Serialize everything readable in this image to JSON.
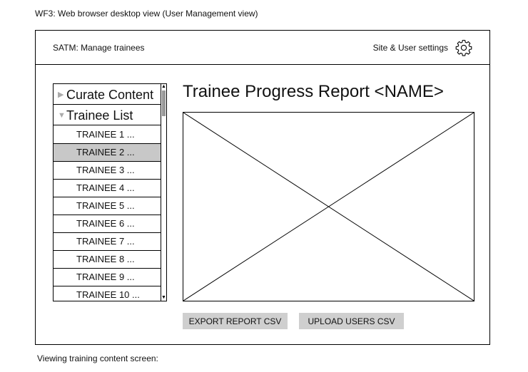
{
  "captions": {
    "top": "WF3: Web browser desktop view (User Management view)",
    "bottom": "Viewing training content screen:"
  },
  "header": {
    "app_title": "SATM: Manage trainees",
    "settings_label": "Site & User settings",
    "settings_icon": "gear-icon"
  },
  "sidebar": {
    "curate": {
      "label": "Curate Content",
      "icon": "triangle-right"
    },
    "trainee_list": {
      "label": "Trainee List",
      "icon": "triangle-down"
    },
    "trainees": [
      "TRAINEE 1 ...",
      "TRAINEE 2 ...",
      "TRAINEE 3 ...",
      "TRAINEE 4 ...",
      "TRAINEE 5 ...",
      "TRAINEE 6 ...",
      "TRAINEE 7 ...",
      "TRAINEE 8 ...",
      "TRAINEE 9 ...",
      "TRAINEE 10 ..."
    ],
    "selected_index": 1
  },
  "main": {
    "report_title": "Trainee Progress Report <NAME>",
    "export_button": "EXPORT REPORT CSV",
    "upload_button": "UPLOAD USERS CSV"
  },
  "colors": {
    "selected_row": "#c8c8c8",
    "button_bg": "#cfcfcf"
  }
}
